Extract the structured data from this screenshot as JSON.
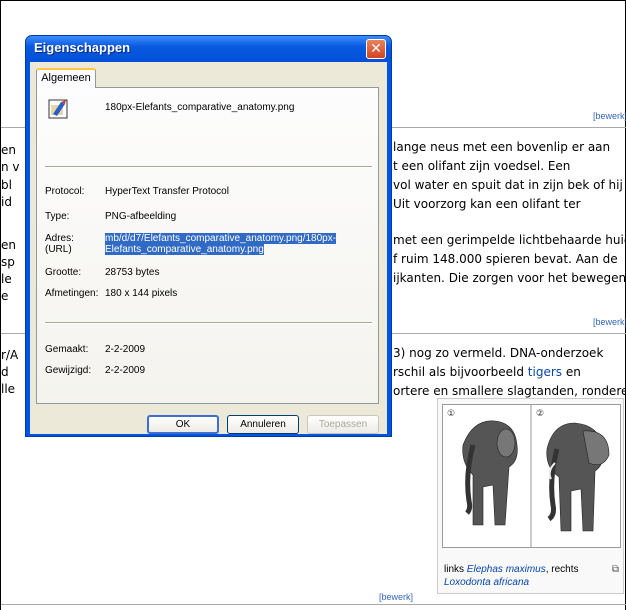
{
  "dialog": {
    "title": "Eigenschappen",
    "tab": "Algemeen",
    "filename": "180px-Elefants_comparative_anatomy.png",
    "protocol_label": "Protocol:",
    "protocol": "HyperText Transfer Protocol",
    "type_label": "Type:",
    "type": "PNG-afbeelding",
    "address_label_1": "Adres:",
    "address_label_2": "(URL)",
    "address_line_1": "mb/d/d7/Elefants_comparative_anatomy.png/180px-",
    "address_line_2": "Elefants_comparative_anatomy.png",
    "size_label": "Grootte:",
    "size": "28753 bytes",
    "dims_label": "Afmetingen:",
    "dims": "180 x 144 pixels",
    "created_label": "Gemaakt:",
    "created": "2-2-2009",
    "modified_label": "Gewijzigd:",
    "modified": "2-2-2009",
    "ok": "OK",
    "cancel": "Annuleren",
    "apply": "Toepassen",
    "close_glyph": "✕"
  },
  "page": {
    "edit_label": "[bewerk]",
    "para1": [
      "lange neus met een bovenlip er aan",
      "t een olifant zijn voedsel. Een",
      "vol water en spuit dat in zijn bek of hij",
      "Uit voorzorg kan een olifant ter"
    ],
    "para1_left": [
      "en",
      "n v",
      "bl",
      "id"
    ],
    "para2": [
      "met een gerimpelde lichtbehaarde huid.",
      "f ruim 148.000 spieren bevat. Aan de",
      "ijkanten. Die zorgen voor het bewegen"
    ],
    "para2_left": [
      "en",
      "sp",
      "le",
      "e"
    ],
    "para3_a": "3) nog zo vermeld. DNA-onderzoek",
    "para3_b_pre": "rschil als bijvoorbeeld ",
    "para3_b_link": "tigers",
    "para3_b_post": " en",
    "para3_c": "ortere en smallere slagtanden, rondere",
    "para3_left": [
      "r/A",
      "d",
      "lle"
    ],
    "caption_pre": "links ",
    "caption_link1": "Elephas maximus",
    "caption_mid": ", rechts",
    "caption_link2": "Loxodonta africana",
    "panel_label_1": "①",
    "panel_label_2": "②",
    "magnify": "⧉"
  },
  "colors": {
    "accent": "#0054e3",
    "selection": "#316ac5",
    "link": "#0645ad"
  }
}
